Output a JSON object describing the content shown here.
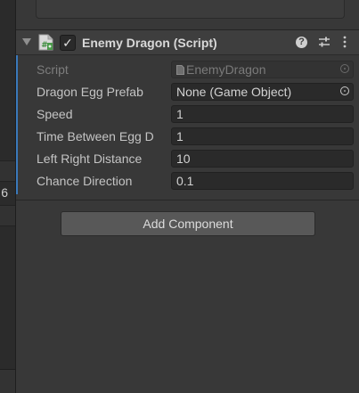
{
  "side_panel": {
    "digit": "6"
  },
  "component": {
    "enabled": true,
    "check_glyph": "✓",
    "title": "Enemy Dragon (Script)",
    "help_glyph": "?",
    "icons": {
      "fold": "triangle-down-icon",
      "script": "csharp-script-icon",
      "help": "help-icon",
      "presets": "presets-sliders-icon",
      "more": "kebab-menu-icon"
    },
    "properties": [
      {
        "label": "Script",
        "value": "EnemyDragon",
        "type": "object-ref",
        "disabled": true
      },
      {
        "label": "Dragon Egg Prefab",
        "value": "None (Game Object)",
        "type": "object-ref",
        "disabled": false
      },
      {
        "label": "Speed",
        "value": "1",
        "type": "float"
      },
      {
        "label": "Time Between Egg D",
        "value": "1",
        "type": "float"
      },
      {
        "label": "Left Right Distance",
        "value": "10",
        "type": "float"
      },
      {
        "label": "Chance Direction",
        "value": "0.1",
        "type": "float"
      }
    ]
  },
  "add_component_label": "Add Component",
  "colors": {
    "background": "#383838",
    "header": "#3e3e3e",
    "field_bg": "#2a2a2a",
    "accent": "#3a79bb",
    "button": "#585858"
  }
}
